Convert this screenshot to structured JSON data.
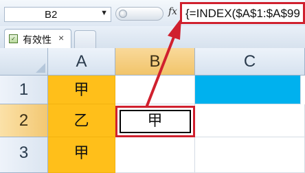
{
  "formula_bar": {
    "name_box": "B2",
    "fx_label": "fx",
    "formula": "{=INDEX($A$1:$A$99"
  },
  "sheet_tabs": {
    "active_label": "有效性",
    "close_glyph": "×"
  },
  "grid": {
    "columns": [
      "A",
      "B",
      "C"
    ],
    "rows": [
      "1",
      "2",
      "3"
    ],
    "cells": {
      "A1": "甲",
      "A2": "乙",
      "A3": "甲",
      "B2": "甲"
    }
  },
  "colors": {
    "highlight_orange": "#ffbf1a",
    "highlight_blue": "#00b1ee",
    "annotation_red": "#d0202e"
  }
}
